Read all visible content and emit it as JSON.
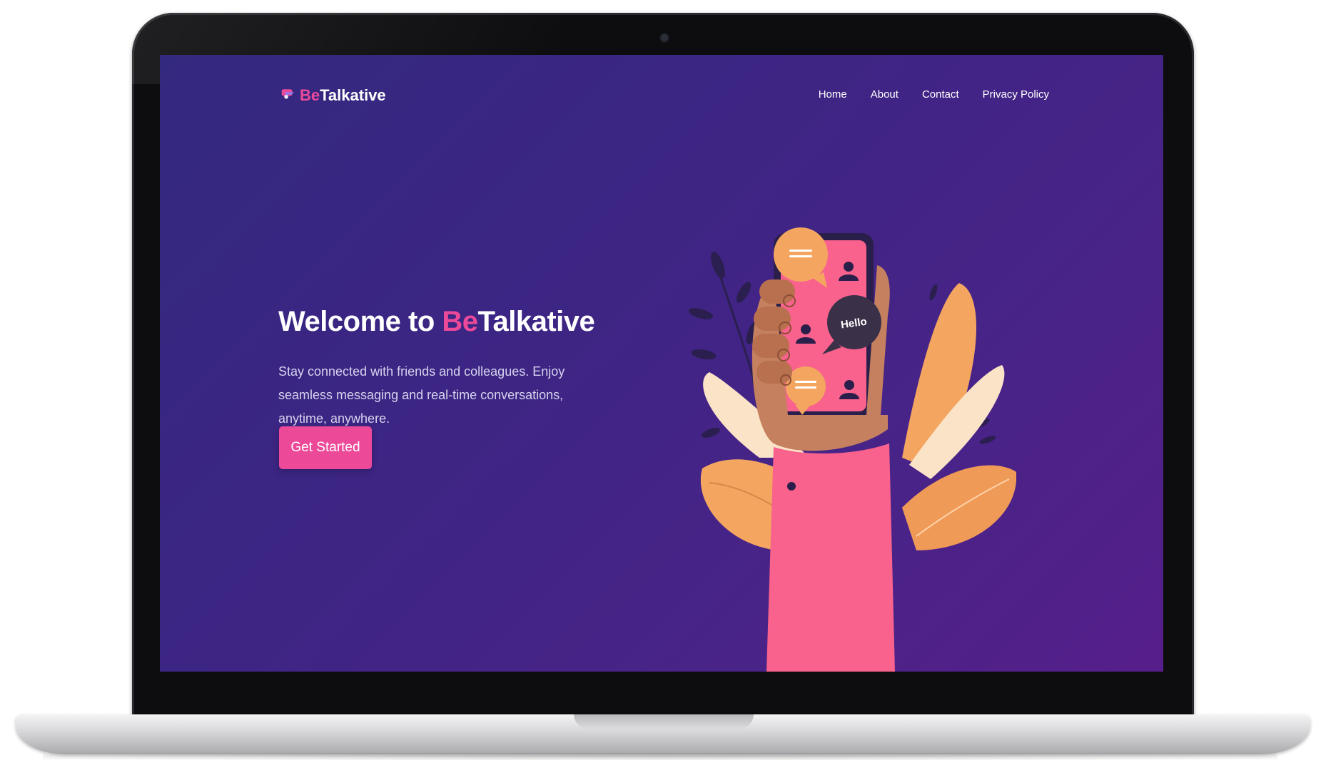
{
  "brand": {
    "name_accent": "Be",
    "name_rest": "Talkative",
    "logo_icon": "chat-bubble-logo-icon"
  },
  "nav": {
    "links": [
      {
        "label": "Home"
      },
      {
        "label": "About"
      },
      {
        "label": "Contact"
      },
      {
        "label": "Privacy Policy"
      }
    ]
  },
  "hero": {
    "title_prefix": "Welcome to ",
    "title_accent": "Be",
    "title_rest": "Talkative",
    "description": "Stay connected with friends and colleagues. Enjoy seamless messaging and real-time conversations, anytime, anywhere.",
    "cta_label": "Get Started"
  },
  "illustration": {
    "bubble_text": "Hello"
  },
  "colors": {
    "accent": "#ec4a99",
    "background_start": "#33297f",
    "background_end": "#561e8a",
    "text": "#ffffff"
  }
}
